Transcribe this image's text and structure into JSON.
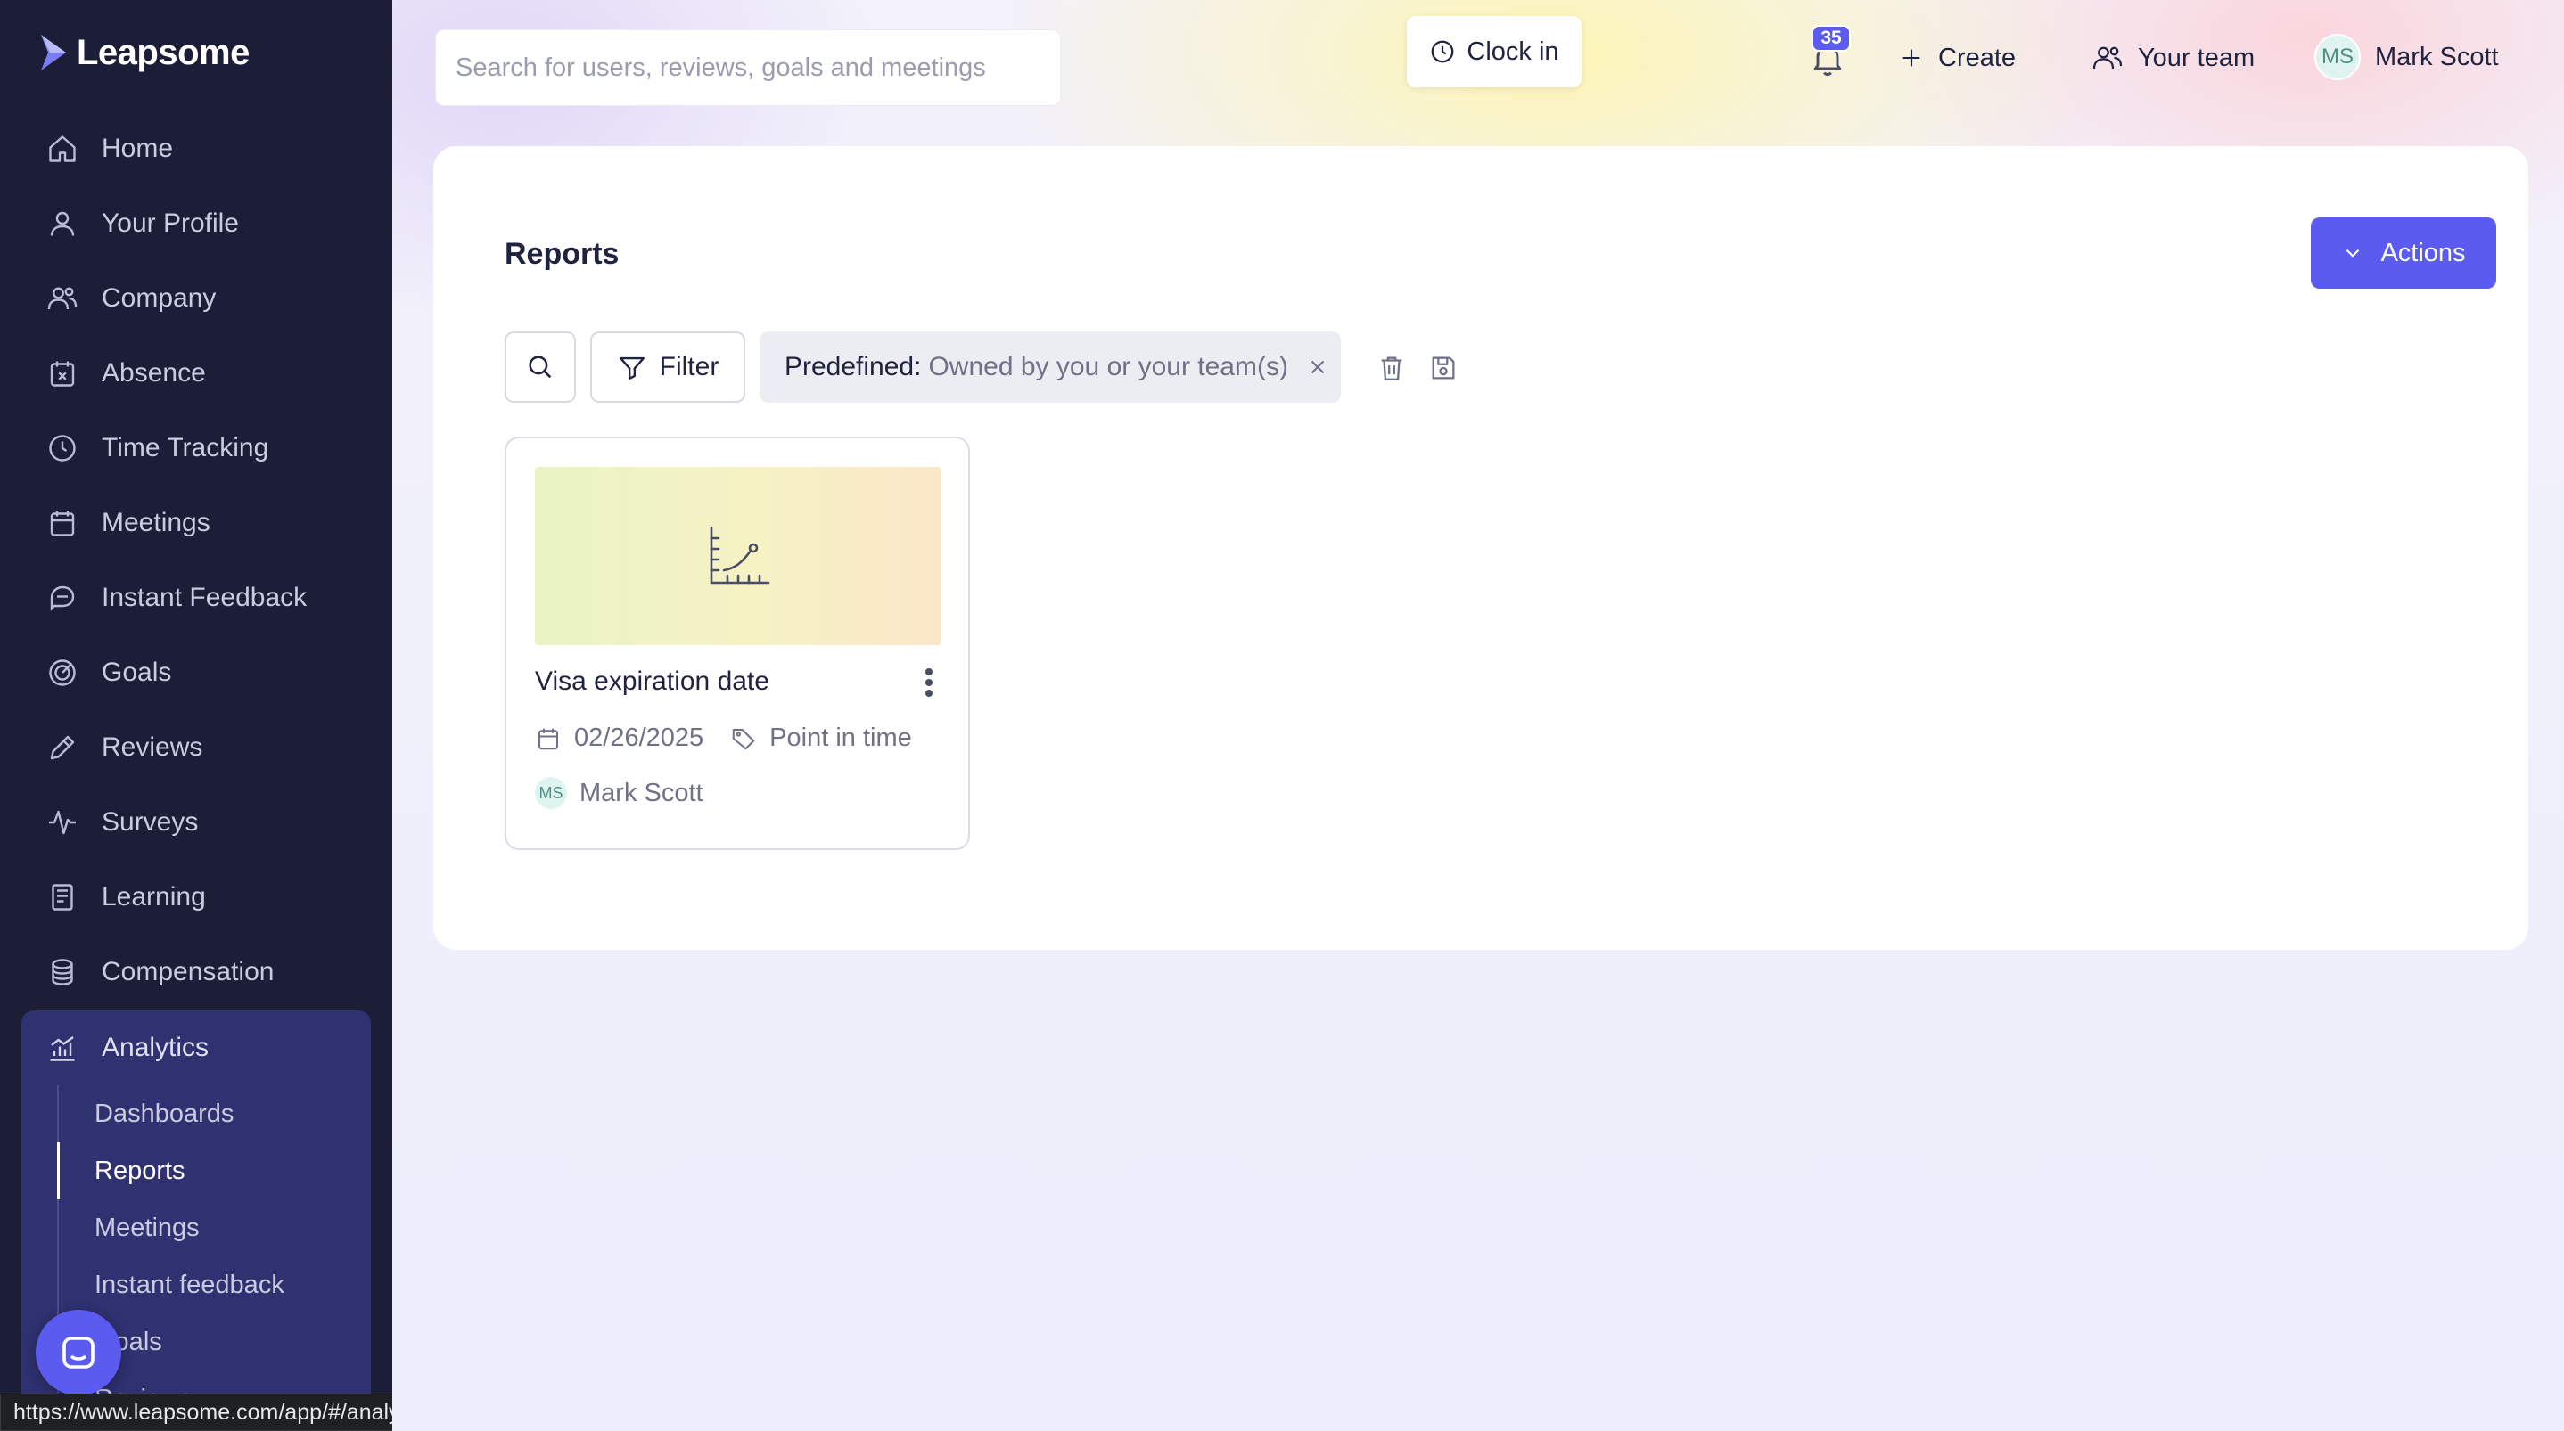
{
  "app": {
    "brand": "Leapsome"
  },
  "sidebar": {
    "items": [
      {
        "label": "Home",
        "icon": "home-icon"
      },
      {
        "label": "Your Profile",
        "icon": "user-icon"
      },
      {
        "label": "Company",
        "icon": "users-icon"
      },
      {
        "label": "Absence",
        "icon": "calendar-x-icon"
      },
      {
        "label": "Time Tracking",
        "icon": "clock-icon"
      },
      {
        "label": "Meetings",
        "icon": "calendar-icon"
      },
      {
        "label": "Instant Feedback",
        "icon": "chat-icon"
      },
      {
        "label": "Goals",
        "icon": "target-icon"
      },
      {
        "label": "Reviews",
        "icon": "pencil-icon"
      },
      {
        "label": "Surveys",
        "icon": "pulse-icon"
      },
      {
        "label": "Learning",
        "icon": "book-icon"
      },
      {
        "label": "Compensation",
        "icon": "coins-icon"
      }
    ],
    "analytics": {
      "label": "Analytics",
      "icon": "bar-chart-icon",
      "sub_items": [
        {
          "label": "Dashboards",
          "active": false
        },
        {
          "label": "Reports",
          "active": true
        },
        {
          "label": "Meetings",
          "active": false
        },
        {
          "label": "Instant feedback",
          "active": false
        },
        {
          "label": "Goals",
          "active": false
        },
        {
          "label": "Reviews",
          "active": false
        }
      ]
    }
  },
  "status_bar": {
    "url": "https://www.leapsome.com/app/#/analytics/reports/hr"
  },
  "topbar": {
    "search_placeholder": "Search for users, reviews, goals and meetings",
    "clock_in_label": "Clock in",
    "notifications_count": "35",
    "create_label": "Create",
    "your_team_label": "Your team",
    "user_initials": "MS",
    "user_name": "Mark Scott"
  },
  "reports_page": {
    "title": "Reports",
    "actions_label": "Actions",
    "filter_label": "Filter",
    "chip_key": "Predefined:",
    "chip_value": "Owned by you or your team(s)"
  },
  "reports": [
    {
      "title": "Visa expiration date",
      "date": "02/26/2025",
      "type": "Point in time",
      "owner_initials": "MS",
      "owner_name": "Mark Scott"
    }
  ],
  "colors": {
    "sidebar_bg": "#1c1e38",
    "sidebar_active_bg": "#2f3170",
    "accent": "#5b5bf0"
  }
}
